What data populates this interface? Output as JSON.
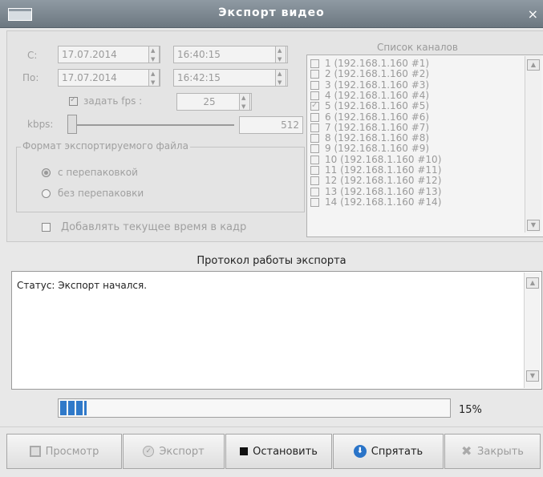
{
  "window": {
    "title": "Экспорт видео",
    "close": "×"
  },
  "form": {
    "from_label": "С:",
    "to_label": "По:",
    "from_date": "17.07.2014",
    "from_time": "16:40:15",
    "to_date": "17.07.2014",
    "to_time": "16:42:15",
    "fps_label": "задать fps :",
    "fps_value": "25",
    "kbps_label": "kbps:",
    "kbps_value": "512",
    "format_title": "Формат экспортируемого файла",
    "format_options": [
      "с перепаковкой",
      "без перепаковки"
    ],
    "add_time_label": "Добавлять текущее время в кадр"
  },
  "channels": {
    "title": "Список каналов",
    "items": [
      "1 (192.168.1.160 #1)",
      "2 (192.168.1.160 #2)",
      "3 (192.168.1.160 #3)",
      "4 (192.168.1.160 #4)",
      "5 (192.168.1.160 #5)",
      "6 (192.168.1.160 #6)",
      "7 (192.168.1.160 #7)",
      "8 (192.168.1.160 #8)",
      "9 (192.168.1.160 #9)",
      "10 (192.168.1.160 #10)",
      "11 (192.168.1.160 #11)",
      "12 (192.168.1.160 #12)",
      "13 (192.168.1.160 #13)",
      "14 (192.168.1.160 #14)"
    ],
    "checked_index": 4
  },
  "protocol": {
    "title": "Протокол работы экспорта",
    "log": "Статус: Экспорт начался."
  },
  "progress": {
    "value_fraction": 0.15,
    "label": "15%"
  },
  "buttons": {
    "preview": "Просмотр",
    "export": "Экспорт",
    "stop": "Остановить",
    "hide": "Спрятать",
    "close": "Закрыть"
  },
  "colors": {
    "accent": "#2f79c9",
    "disabled_text": "#9c9c9c"
  }
}
